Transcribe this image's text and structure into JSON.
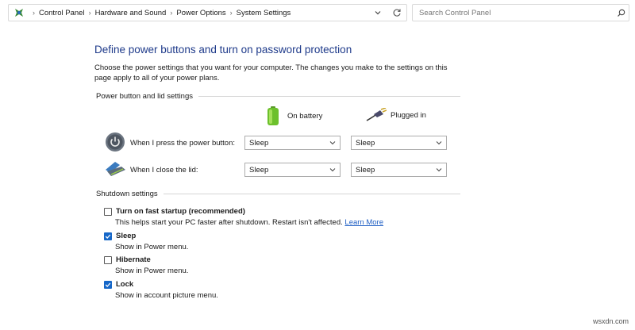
{
  "address_bar": {
    "breadcrumbs": [
      "Control Panel",
      "Hardware and Sound",
      "Power Options",
      "System Settings"
    ],
    "icon": "control-panel-icon"
  },
  "search": {
    "placeholder": "Search Control Panel"
  },
  "main": {
    "title": "Define power buttons and turn on password protection",
    "description": "Choose the power settings that you want for your computer. The changes you make to the settings on this page apply to all of your power plans.",
    "power_group": {
      "label": "Power button and lid settings",
      "columns": {
        "battery": "On battery",
        "plugged": "Plugged in"
      },
      "rows": [
        {
          "label": "When I press the power button:",
          "battery": "Sleep",
          "plugged": "Sleep",
          "icon": "power-button-icon"
        },
        {
          "label": "When I close the lid:",
          "battery": "Sleep",
          "plugged": "Sleep",
          "icon": "laptop-lid-icon"
        }
      ]
    },
    "shutdown_group": {
      "label": "Shutdown settings",
      "options": [
        {
          "label": "Turn on fast startup (recommended)",
          "desc": "This helps start your PC faster after shutdown. Restart isn't affected.",
          "link": "Learn More",
          "checked": false
        },
        {
          "label": "Sleep",
          "desc": "Show in Power menu.",
          "checked": true
        },
        {
          "label": "Hibernate",
          "desc": "Show in Power menu.",
          "checked": false
        },
        {
          "label": "Lock",
          "desc": "Show in account picture menu.",
          "checked": true
        }
      ]
    }
  },
  "watermark": "wsxdn.com",
  "colors": {
    "title": "#1e3a8a",
    "checkbox_checked": "#1667c8",
    "link": "#1f5fc4"
  }
}
